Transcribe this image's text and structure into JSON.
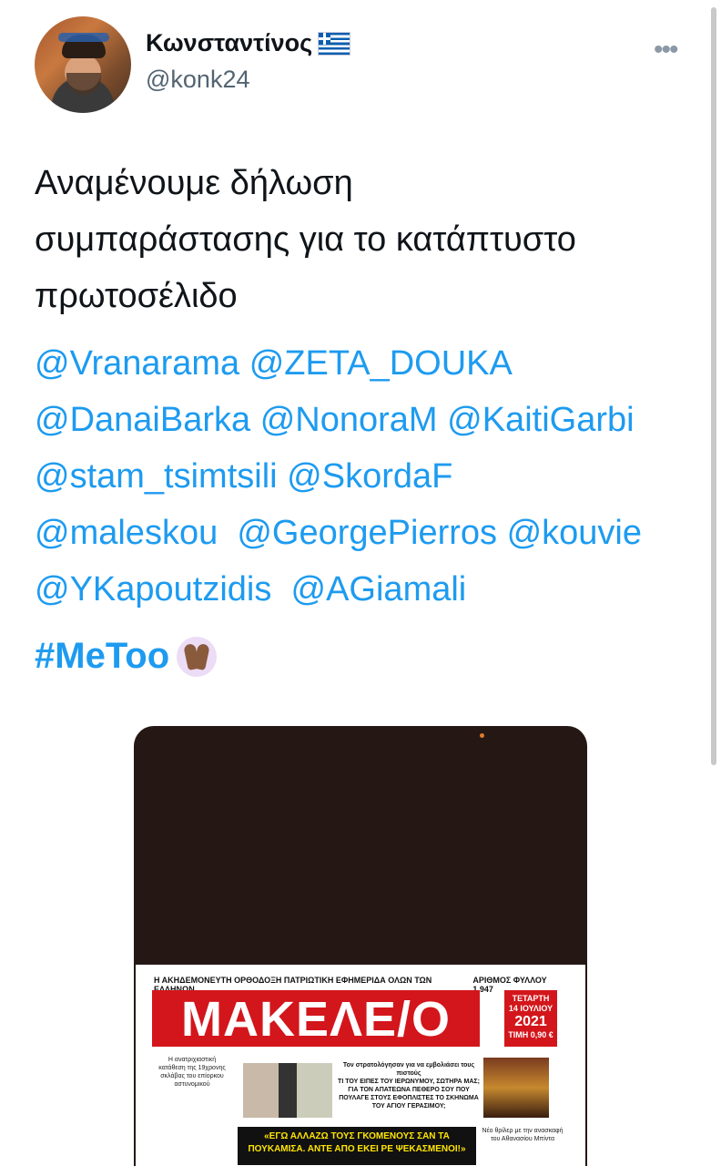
{
  "author": {
    "display_name": "Κωνσταντίνος",
    "handle": "@konk24",
    "avatar_icon": "profile-photo",
    "flag_icon": "greece-flag"
  },
  "menu": {
    "more_label": "•••"
  },
  "tweet": {
    "lines": [
      "Αναμένουμε δήλωση",
      "συμπαράστασης για το κατάπτυστο",
      "πρωτοσέλιδο"
    ],
    "mentions": [
      "@Vranarama",
      "@ZETA_DOUKA",
      "@DanaiBarka",
      "@NonoraM",
      "@KaitiGarbi",
      "@stam_tsimtsili",
      "@SkordaF",
      "@maleskou",
      "@GeorgePierros",
      "@kouvie",
      "@YKapoutzidis",
      "@AGiamali"
    ],
    "hashtag": "#MeToo",
    "hashtag_emoji": "raised-hands-icon"
  },
  "colors": {
    "link": "#1d9bf0",
    "text": "#0f1419",
    "muted": "#536471"
  },
  "newspaper": {
    "tagline": "Η ΑΚΗΔΕΜΟΝΕΥΤΗ ΟΡΘΟΔΟΞΗ ΠΑΤΡΙΩΤΙΚΗ ΕΦΗΜΕΡΙΔΑ ΟΛΩΝ ΤΩΝ ΕΛΛΗΝΩΝ",
    "issue": "ΑΡΙΘΜΟΣ ΦΥΛΛΟΥ 1.947",
    "masthead": "ΜΑΚΕΛΕ/Ο",
    "day": "ΤΕΤΑΡΤΗ",
    "date": "14 ΙΟΥΛΙΟΥ",
    "year": "2021",
    "price": "ΤΙΜΗ 0,90 €",
    "left_text": "Η ανατριχιαστική κατάθεση της 19χρονης σκλάβας του επίορκου αστυνομικού",
    "headline_intro": "Τον στρατολόγησαν για να εμβολιάσει τους πιστούς",
    "headline": "ΤΙ ΤΟΥ ΕΙΠΕΣ ΤΟΥ ΙΕΡΩΝΥΜΟΥ, ΣΩΤΗΡΑ ΜΑΣ; ΓΙΑ ΤΟΝ ΑΠΑΤΕΩΝΑ ΠΕΘΕΡΟ ΣΟΥ ΠΟΥ ΠΟΥΛΑΓΕ ΣΤΟΥΣ ΕΦΟΠΛΙΣΤΕΣ ΤΟ ΣΚΗΝΩΜΑ ΤΟΥ ΑΓΙΟΥ ΓΕΡΑΣΙΜΟΥ;",
    "quote": "«ΕΓΩ ΑΛΛΑΖΩ ΤΟΥΣ ΓΚΟΜΕΝΟΥΣ ΣΑΝ ΤΑ ΠΟΥΚΑΜΙΣΑ. ΑΝΤΕ ΑΠΟ ΕΚΕΙ ΡΕ ΨΕΚΑΣΜΕΝΟΙ!»",
    "side_text": "Νέο θρίλερ με την ανασκαφή του Αθανασίου Μπίντα"
  }
}
